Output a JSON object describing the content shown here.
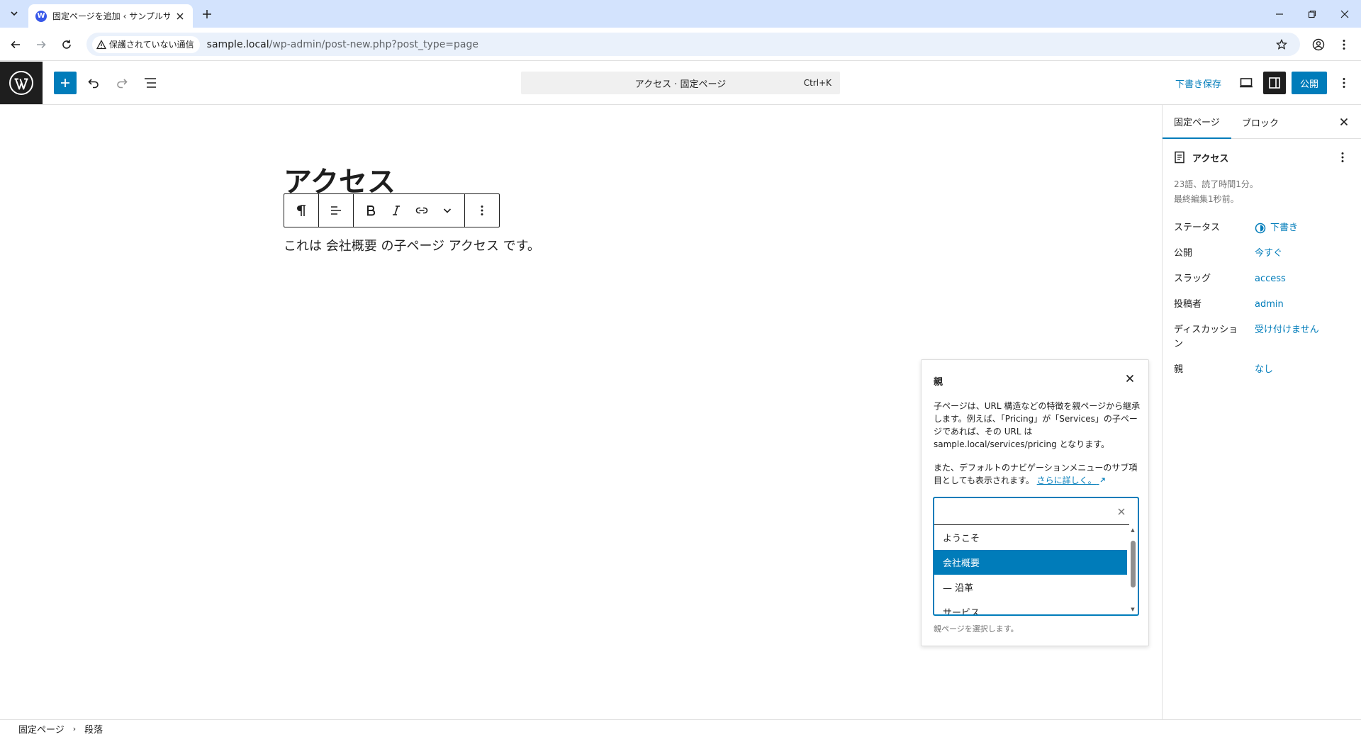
{
  "browser": {
    "tab_title": "固定ページを追加 ‹ サンプルサイト — WordPress",
    "security_label": "保護されていない通信",
    "url_host": "sample.local",
    "url_path": "/wp-admin/post-new.php?post_type=page"
  },
  "header": {
    "command_label": "アクセス · 固定ページ",
    "command_shortcut": "Ctrl+K",
    "save_draft_label": "下書き保存",
    "publish_label": "公開"
  },
  "editor": {
    "title": "アクセス",
    "paragraph": "これは 会社概要 の子ページ アクセス です。"
  },
  "popover": {
    "title": "親",
    "description": "子ページは、URL 構造などの特徴を親ページから継承します。例えば、「Pricing」が「Services」の子ページであれば、その URL は sample.local/services/pricing となります。",
    "description2": "また、デフォルトのナビゲーションメニューのサブ項目としても表示されます。",
    "learn_more": "さらに詳しく。",
    "options": [
      {
        "label": "ようこそ",
        "selected": false
      },
      {
        "label": "会社概要",
        "selected": true
      },
      {
        "label": "— 沿革",
        "selected": false
      },
      {
        "label": "サービス",
        "selected": false
      }
    ],
    "help": "親ページを選択します。"
  },
  "sidebar": {
    "tab_page": "固定ページ",
    "tab_block": "ブロック",
    "doc_title": "アクセス",
    "meta_words": "23語、読了時間1分。",
    "meta_edited": "最終編集1秒前。",
    "rows": [
      {
        "label": "ステータス",
        "value": "下書き"
      },
      {
        "label": "公開",
        "value": "今すぐ"
      },
      {
        "label": "スラッグ",
        "value": "access"
      },
      {
        "label": "投稿者",
        "value": "admin"
      },
      {
        "label": "ディスカッション",
        "value": "受け付けません"
      },
      {
        "label": "親",
        "value": "なし"
      }
    ]
  },
  "footer": {
    "crumb1": "固定ページ",
    "crumb2": "段落"
  },
  "colors": {
    "accent": "#007cba",
    "dark": "#1e1e1e",
    "tabbar": "#d3e3fd"
  }
}
